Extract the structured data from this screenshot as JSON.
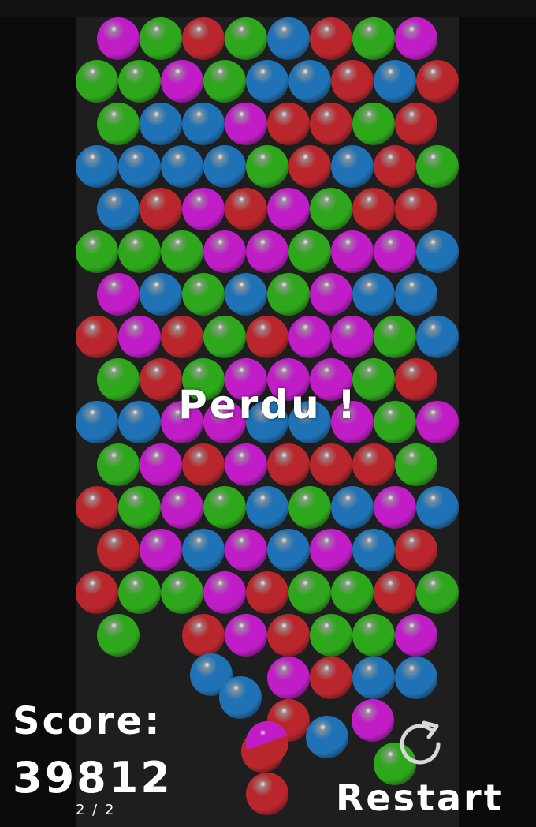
{
  "game": {
    "lost_message": "Perdu !",
    "score_label": "Score:",
    "score_value": "39812",
    "page_indicator": "2 / 2",
    "restart_label": "Restart",
    "restart_icon": "restart-arrow-icon"
  },
  "colors": {
    "background": "#0b0b0b",
    "board": "#1e1e1e",
    "M": "#c01dc7",
    "G": "#2ea71c",
    "R": "#b9262c",
    "B": "#1f72b5"
  },
  "grid_rows": [
    "MGRGBRGM",
    "GGMGBBRBR",
    "GBBMRRGR",
    "BBBBGRBRG",
    "BRMRMGRR",
    "GGGMMGMMB",
    "MBGBGMBB",
    "RMRGRMMGB",
    "GRGMMMGR",
    "BBMMBBMGM",
    "GMRMRRRG",
    "RGMGBGBMB",
    "RMBMBMBR",
    "RGGMRGGRG",
    "G.RMRGGM",
    "....MRBB"
  ],
  "falling_bubbles": [
    "B",
    "B",
    "R",
    "B",
    "M",
    "G",
    "R",
    "R",
    "MR"
  ]
}
